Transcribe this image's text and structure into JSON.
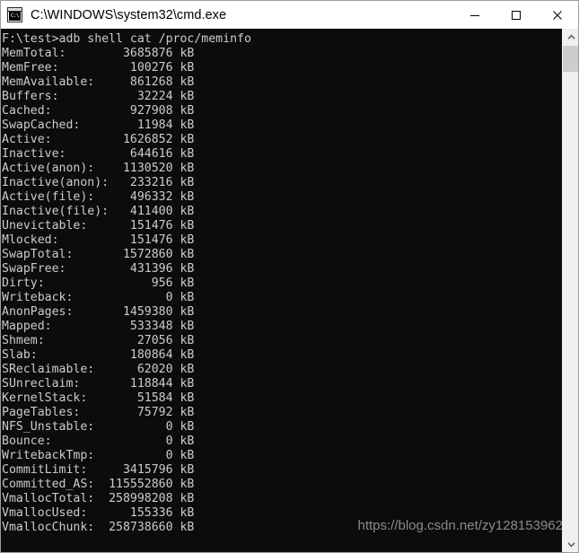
{
  "window": {
    "title": "C:\\WINDOWS\\system32\\cmd.exe",
    "icon": "cmd-console-icon",
    "icon_text": "C:\\",
    "controls": {
      "minimize": "minimize-button",
      "maximize": "maximize-button",
      "close": "close-button"
    },
    "titlebar_bg": "#ffffff",
    "terminal_bg": "#0c0c0c",
    "terminal_fg": "#cccccc"
  },
  "terminal": {
    "prompt_line": "F:\\test>adb shell cat /proc/meminfo",
    "lines": [
      "F:\\test>adb shell cat /proc/meminfo",
      "MemTotal:        3685876 kB",
      "MemFree:          100276 kB",
      "MemAvailable:     861268 kB",
      "Buffers:           32224 kB",
      "Cached:           927908 kB",
      "SwapCached:        11984 kB",
      "Active:          1626852 kB",
      "Inactive:         644616 kB",
      "Active(anon):    1130520 kB",
      "Inactive(anon):   233216 kB",
      "Active(file):     496332 kB",
      "Inactive(file):   411400 kB",
      "Unevictable:      151476 kB",
      "Mlocked:          151476 kB",
      "SwapTotal:       1572860 kB",
      "SwapFree:         431396 kB",
      "Dirty:               956 kB",
      "Writeback:             0 kB",
      "AnonPages:       1459380 kB",
      "Mapped:           533348 kB",
      "Shmem:             27056 kB",
      "Slab:             180864 kB",
      "SReclaimable:      62020 kB",
      "SUnreclaim:       118844 kB",
      "KernelStack:       51584 kB",
      "PageTables:        75792 kB",
      "NFS_Unstable:          0 kB",
      "Bounce:                0 kB",
      "WritebackTmp:          0 kB",
      "CommitLimit:     3415796 kB",
      "Committed_AS:  115552860 kB",
      "VmallocTotal:  258998208 kB",
      "VmallocUsed:      155336 kB",
      "VmallocChunk:  258738660 kB"
    ],
    "meminfo": [
      {
        "key": "MemTotal",
        "value": 3685876,
        "unit": "kB"
      },
      {
        "key": "MemFree",
        "value": 100276,
        "unit": "kB"
      },
      {
        "key": "MemAvailable",
        "value": 861268,
        "unit": "kB"
      },
      {
        "key": "Buffers",
        "value": 32224,
        "unit": "kB"
      },
      {
        "key": "Cached",
        "value": 927908,
        "unit": "kB"
      },
      {
        "key": "SwapCached",
        "value": 11984,
        "unit": "kB"
      },
      {
        "key": "Active",
        "value": 1626852,
        "unit": "kB"
      },
      {
        "key": "Inactive",
        "value": 644616,
        "unit": "kB"
      },
      {
        "key": "Active(anon)",
        "value": 1130520,
        "unit": "kB"
      },
      {
        "key": "Inactive(anon)",
        "value": 233216,
        "unit": "kB"
      },
      {
        "key": "Active(file)",
        "value": 496332,
        "unit": "kB"
      },
      {
        "key": "Inactive(file)",
        "value": 411400,
        "unit": "kB"
      },
      {
        "key": "Unevictable",
        "value": 151476,
        "unit": "kB"
      },
      {
        "key": "Mlocked",
        "value": 151476,
        "unit": "kB"
      },
      {
        "key": "SwapTotal",
        "value": 1572860,
        "unit": "kB"
      },
      {
        "key": "SwapFree",
        "value": 431396,
        "unit": "kB"
      },
      {
        "key": "Dirty",
        "value": 956,
        "unit": "kB"
      },
      {
        "key": "Writeback",
        "value": 0,
        "unit": "kB"
      },
      {
        "key": "AnonPages",
        "value": 1459380,
        "unit": "kB"
      },
      {
        "key": "Mapped",
        "value": 533348,
        "unit": "kB"
      },
      {
        "key": "Shmem",
        "value": 27056,
        "unit": "kB"
      },
      {
        "key": "Slab",
        "value": 180864,
        "unit": "kB"
      },
      {
        "key": "SReclaimable",
        "value": 62020,
        "unit": "kB"
      },
      {
        "key": "SUnreclaim",
        "value": 118844,
        "unit": "kB"
      },
      {
        "key": "KernelStack",
        "value": 51584,
        "unit": "kB"
      },
      {
        "key": "PageTables",
        "value": 75792,
        "unit": "kB"
      },
      {
        "key": "NFS_Unstable",
        "value": 0,
        "unit": "kB"
      },
      {
        "key": "Bounce",
        "value": 0,
        "unit": "kB"
      },
      {
        "key": "WritebackTmp",
        "value": 0,
        "unit": "kB"
      },
      {
        "key": "CommitLimit",
        "value": 3415796,
        "unit": "kB"
      },
      {
        "key": "Committed_AS",
        "value": 115552860,
        "unit": "kB"
      },
      {
        "key": "VmallocTotal",
        "value": 258998208,
        "unit": "kB"
      },
      {
        "key": "VmallocUsed",
        "value": 155336,
        "unit": "kB"
      },
      {
        "key": "VmallocChunk",
        "value": 258738660,
        "unit": "kB"
      }
    ]
  },
  "watermark": {
    "text": "https://blog.csdn.net/zy128153962"
  },
  "scrollbar": {
    "up_arrow": "scroll-up-arrow",
    "down_arrow": "scroll-down-arrow",
    "thumb": "scroll-thumb"
  }
}
